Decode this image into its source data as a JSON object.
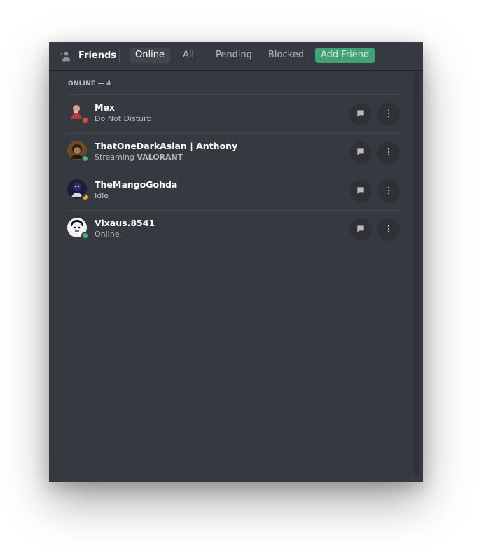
{
  "header": {
    "title": "Friends",
    "tabs": {
      "online": "Online",
      "all": "All",
      "pending": "Pending",
      "blocked": "Blocked",
      "add_friend": "Add Friend"
    }
  },
  "section": {
    "label": "ONLINE — 4"
  },
  "friends": [
    {
      "name": "Mex",
      "status": "Do Not Disturb",
      "presence": "dnd"
    },
    {
      "name": "ThatOneDarkAsian | Anthony",
      "status_prefix": "Streaming ",
      "status_bold": "VALORANT",
      "presence": "online"
    },
    {
      "name": "TheMangoGohda",
      "status": "Idle",
      "presence": "idle"
    },
    {
      "name": "Vixaus.8541",
      "status": "Online",
      "presence": "online"
    }
  ],
  "colors": {
    "background": "#36393f",
    "online": "#43b581",
    "dnd": "#f04747",
    "idle": "#faa61a",
    "add_friend": "#43b581"
  },
  "icons": {
    "friends": "friends-icon",
    "message": "chat-bubble-icon",
    "more": "more-vertical-icon"
  }
}
